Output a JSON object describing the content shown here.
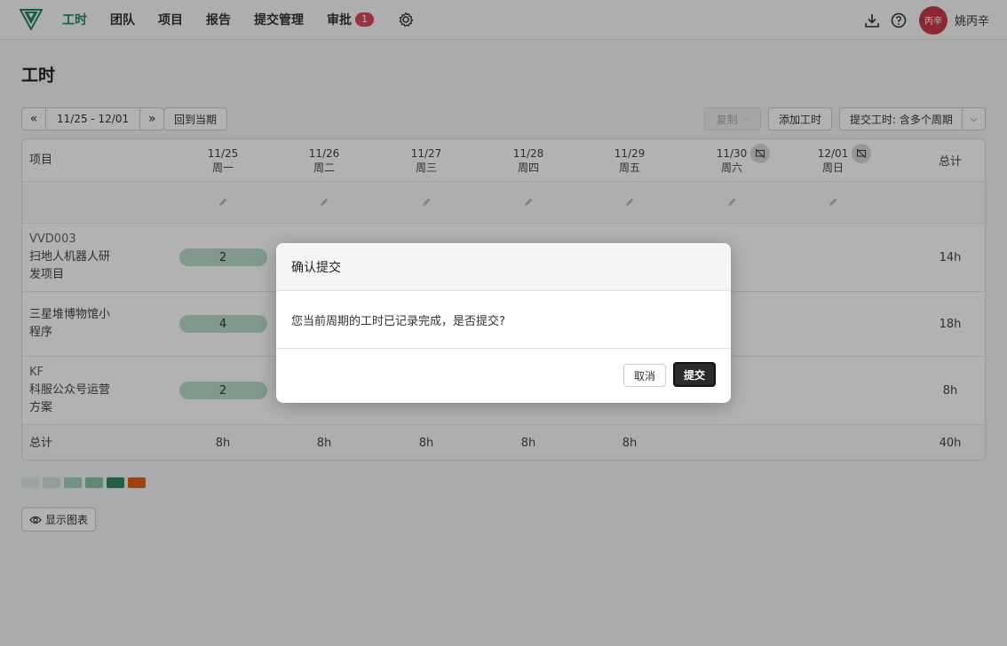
{
  "nav": {
    "items": [
      {
        "label": "工时",
        "active": true
      },
      {
        "label": "团队"
      },
      {
        "label": "项目"
      },
      {
        "label": "报告"
      },
      {
        "label": "提交管理"
      },
      {
        "label": "审批",
        "badge": "1"
      }
    ],
    "settings_icon": "gear-icon"
  },
  "user": {
    "avatar_text": "丙辛",
    "name": "姚丙辛"
  },
  "page": {
    "title": "工时"
  },
  "toolbar": {
    "date_range": "11/25 - 12/01",
    "back_to_current": "回到当期",
    "copy": "复制",
    "add_hours": "添加工时",
    "submit": "提交工时: 含多个周期"
  },
  "table": {
    "header": {
      "project": "项目",
      "total": "总计",
      "days": [
        {
          "date": "11/25",
          "weekday": "周一"
        },
        {
          "date": "11/26",
          "weekday": "周二"
        },
        {
          "date": "11/27",
          "weekday": "周三"
        },
        {
          "date": "11/28",
          "weekday": "周四"
        },
        {
          "date": "11/29",
          "weekday": "周五"
        },
        {
          "date": "11/30",
          "weekday": "周六"
        },
        {
          "date": "12/01",
          "weekday": "周日"
        }
      ]
    },
    "rows": [
      {
        "code": "VVD003",
        "name_line1": "扫地人机器人研",
        "name_line2": "发项目",
        "first_day": "2",
        "total": "14h"
      },
      {
        "code": "",
        "name_line1": "三星堆博物馆小",
        "name_line2": "程序",
        "first_day": "4",
        "total": "18h"
      },
      {
        "code": "KF",
        "name_line1": "科服公众号运营",
        "name_line2": "方案",
        "first_day": "2",
        "total": "8h"
      }
    ],
    "footer": {
      "label": "总计",
      "days": [
        "8h",
        "8h",
        "8h",
        "8h",
        "8h"
      ],
      "total": "40h"
    }
  },
  "legend_colors": [
    "#e2ebe7",
    "#cfe3da",
    "#a9d2be",
    "#8cc3a8",
    "#2f8a62",
    "#e0601f"
  ],
  "show_chart": "显示图表",
  "modal": {
    "title": "确认提交",
    "message": "您当前周期的工时已记录完成，是否提交?",
    "cancel": "取消",
    "confirm": "提交"
  }
}
